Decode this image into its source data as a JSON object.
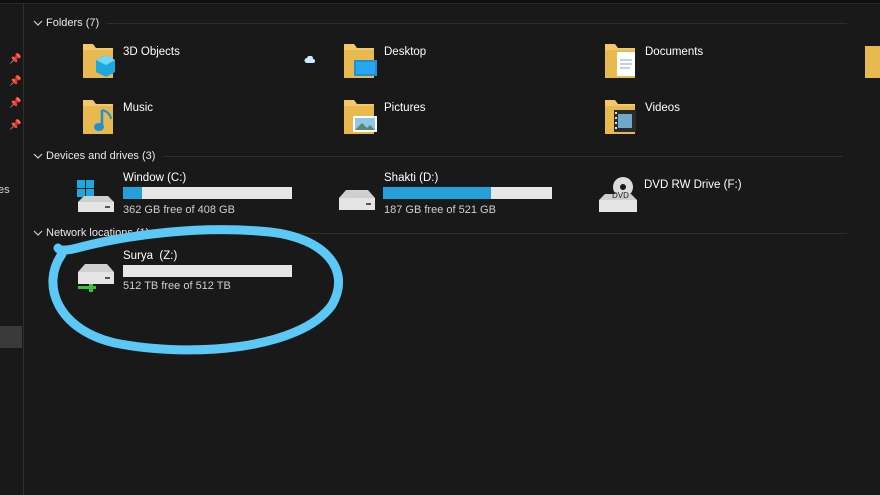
{
  "sidebar": {
    "partial_label": "es"
  },
  "sections": {
    "folders": {
      "title": "Folders (7)"
    },
    "devices": {
      "title": "Devices and drives (3)"
    },
    "network": {
      "title": "Network locations (1)"
    }
  },
  "folders": [
    {
      "label": "3D Objects",
      "icon": "3d-objects-folder-icon"
    },
    {
      "label": "Desktop",
      "icon": "desktop-folder-icon"
    },
    {
      "label": "Documents",
      "icon": "documents-folder-icon"
    },
    {
      "label": "Music",
      "icon": "music-folder-icon"
    },
    {
      "label": "Pictures",
      "icon": "pictures-folder-icon"
    },
    {
      "label": "Videos",
      "icon": "videos-folder-icon"
    }
  ],
  "drives": [
    {
      "label": "Window (C:)",
      "free_text": "362 GB free of 408 GB",
      "used_fraction": 0.113,
      "icon": "windows-drive-icon"
    },
    {
      "label": "Shakti (D:)",
      "free_text": "187 GB free of 521 GB",
      "used_fraction": 0.641,
      "icon": "hard-drive-icon"
    },
    {
      "label": "DVD RW Drive (F:)",
      "icon": "dvd-drive-icon"
    }
  ],
  "network_drives": [
    {
      "label": "Surya  (Z:)",
      "free_text": "512 TB free of 512 TB",
      "used_fraction": 0.0,
      "icon": "network-drive-icon"
    }
  ],
  "colors": {
    "background": "#191919",
    "progress_fill": "#26a0da",
    "progress_track": "#e6e6e6",
    "annotation_stroke": "#5cc8f5"
  }
}
